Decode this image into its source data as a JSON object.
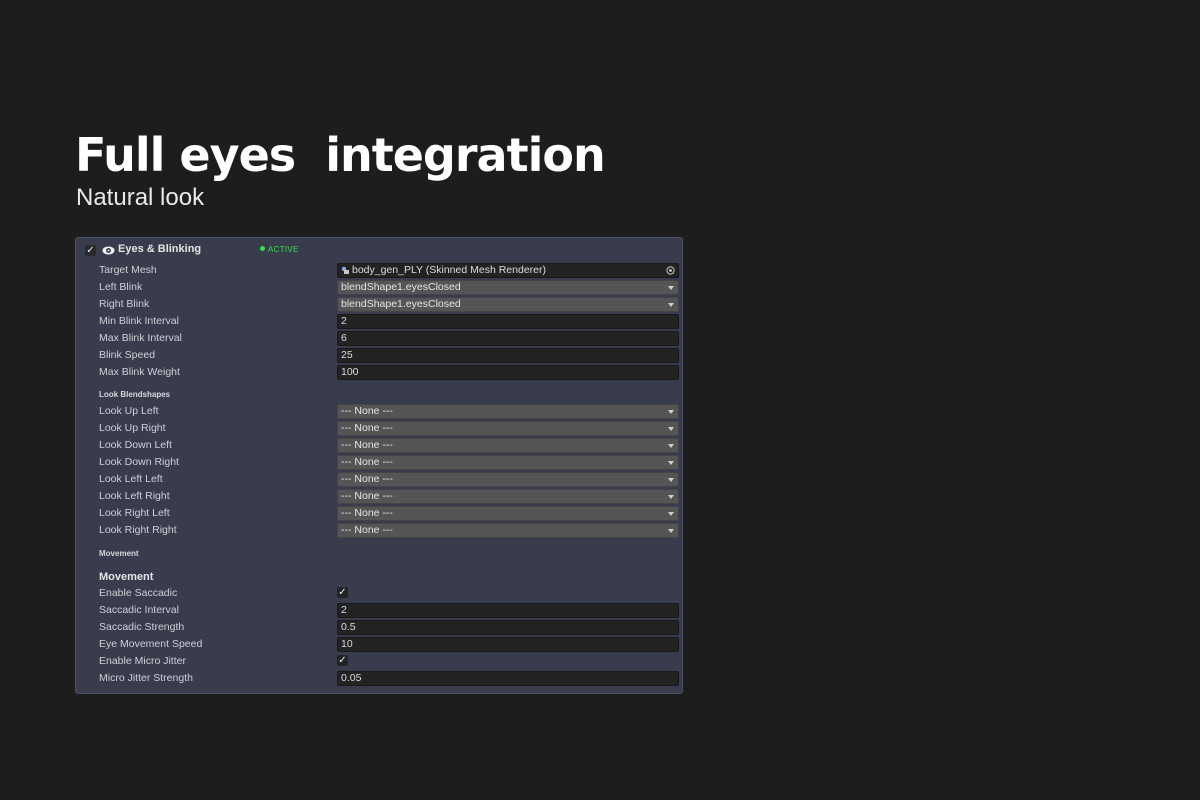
{
  "hero": {
    "title": "Full eyes  integration",
    "subtitle": "Natural look"
  },
  "panel": {
    "title": "Eyes & Blinking",
    "status": "ACTIVE",
    "enabled": true,
    "icon": "eye-icon",
    "status_color": "#3cdc4c",
    "background": "#383c4d"
  },
  "main_fields": [
    {
      "label": "Target Mesh",
      "value": "body_gen_PLY (Skinned Mesh Renderer)",
      "kind": "object"
    },
    {
      "label": "Left Blink",
      "value": "blendShape1.eyesClosed",
      "kind": "dropdown"
    },
    {
      "label": "Right Blink",
      "value": "blendShape1.eyesClosed",
      "kind": "dropdown"
    },
    {
      "label": "Min Blink Interval",
      "value": "2",
      "kind": "number"
    },
    {
      "label": "Max Blink Interval",
      "value": "6",
      "kind": "number"
    },
    {
      "label": "Blink Speed",
      "value": "25",
      "kind": "number"
    },
    {
      "label": "Max Blink Weight",
      "value": "100",
      "kind": "number"
    }
  ],
  "look_section": {
    "title": "Look Blendshapes",
    "fields": [
      {
        "label": "Look Up Left",
        "value": "--- None ---"
      },
      {
        "label": "Look Up Right",
        "value": "--- None ---"
      },
      {
        "label": "Look Down Left",
        "value": "--- None ---"
      },
      {
        "label": "Look Down Right",
        "value": "--- None ---"
      },
      {
        "label": "Look Left Left",
        "value": "--- None ---"
      },
      {
        "label": "Look Left Right",
        "value": "--- None ---"
      },
      {
        "label": "Look Right Left",
        "value": "--- None ---"
      },
      {
        "label": "Look Right Right",
        "value": "--- None ---"
      }
    ]
  },
  "movement_section": {
    "small_title": "Movement",
    "title": "Movement",
    "fields": [
      {
        "label": "Enable Saccadic",
        "kind": "checkbox",
        "checked": true
      },
      {
        "label": "Saccadic Interval",
        "kind": "number",
        "value": "2"
      },
      {
        "label": "Saccadic Strength",
        "kind": "number",
        "value": "0.5"
      },
      {
        "label": "Eye Movement Speed",
        "kind": "number",
        "value": "10"
      },
      {
        "label": "Enable Micro Jitter",
        "kind": "checkbox",
        "checked": true
      },
      {
        "label": "Micro Jitter Strength",
        "kind": "number",
        "value": "0.05"
      }
    ]
  }
}
